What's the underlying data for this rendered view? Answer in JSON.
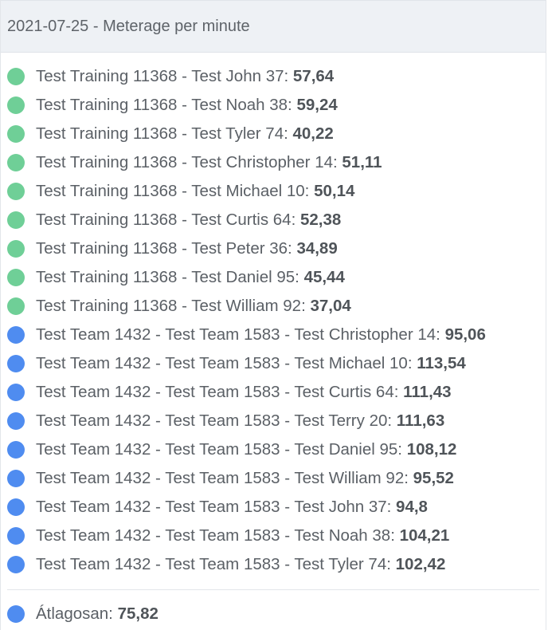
{
  "header": {
    "title": "2021-07-25 - Meterage per minute"
  },
  "colors": {
    "green": "#6fcf97",
    "blue": "#4f8cf0"
  },
  "items": [
    {
      "label": "Test Training 11368 - Test John 37:",
      "value": "57,64",
      "color": "green"
    },
    {
      "label": "Test Training 11368 - Test Noah 38:",
      "value": "59,24",
      "color": "green"
    },
    {
      "label": "Test Training 11368 - Test Tyler 74:",
      "value": "40,22",
      "color": "green"
    },
    {
      "label": "Test Training 11368 - Test Christopher 14:",
      "value": "51,11",
      "color": "green"
    },
    {
      "label": "Test Training 11368 - Test Michael 10:",
      "value": "50,14",
      "color": "green"
    },
    {
      "label": "Test Training 11368 - Test Curtis 64:",
      "value": "52,38",
      "color": "green"
    },
    {
      "label": "Test Training 11368 - Test Peter 36:",
      "value": "34,89",
      "color": "green"
    },
    {
      "label": "Test Training 11368 - Test Daniel 95:",
      "value": "45,44",
      "color": "green"
    },
    {
      "label": "Test Training 11368 - Test William 92:",
      "value": "37,04",
      "color": "green"
    },
    {
      "label": "Test Team 1432 - Test Team 1583 - Test Christopher 14:",
      "value": "95,06",
      "color": "blue"
    },
    {
      "label": "Test Team 1432 - Test Team 1583 - Test Michael 10:",
      "value": "113,54",
      "color": "blue"
    },
    {
      "label": "Test Team 1432 - Test Team 1583 - Test Curtis 64:",
      "value": "111,43",
      "color": "blue"
    },
    {
      "label": "Test Team 1432 - Test Team 1583 - Test Terry 20:",
      "value": "111,63",
      "color": "blue"
    },
    {
      "label": "Test Team 1432 - Test Team 1583 - Test Daniel 95:",
      "value": "108,12",
      "color": "blue"
    },
    {
      "label": "Test Team 1432 - Test Team 1583 - Test William 92:",
      "value": "95,52",
      "color": "blue"
    },
    {
      "label": "Test Team 1432 - Test Team 1583 - Test John 37:",
      "value": "94,8",
      "color": "blue"
    },
    {
      "label": "Test Team 1432 - Test Team 1583 - Test Noah 38:",
      "value": "104,21",
      "color": "blue"
    },
    {
      "label": "Test Team 1432 - Test Team 1583 - Test Tyler 74:",
      "value": "102,42",
      "color": "blue"
    }
  ],
  "average": {
    "label": "Átlagosan:",
    "value": "75,82",
    "color": "blue"
  }
}
